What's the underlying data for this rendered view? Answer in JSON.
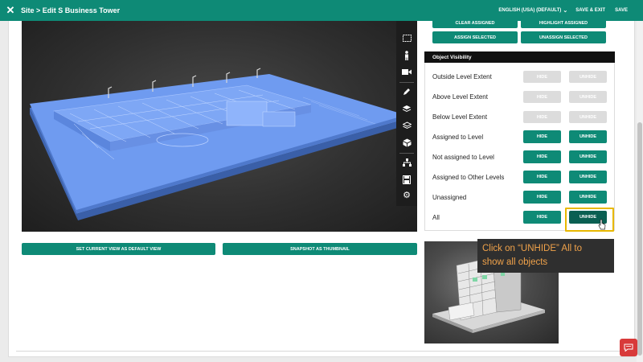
{
  "header": {
    "title": "Site > Edit S Business Tower",
    "language": "ENGLISH (USA) (DEFAULT)",
    "save_exit": "SAVE & EXIT",
    "save": "SAVE"
  },
  "assign_buttons": {
    "clear_assigned": "CLEAR ASSIGNED",
    "highlight_assigned": "HIGHLIGHT ASSIGNED",
    "assign_selected": "ASSIGN SELECTED",
    "unassign_selected": "UNASSIGN SELECTED"
  },
  "visibility": {
    "header": "Object Visibility",
    "rows": [
      {
        "label": "Outside Level Extent",
        "hide": "HIDE",
        "unhide": "UNHIDE",
        "enabled": false
      },
      {
        "label": "Above Level Extent",
        "hide": "HIDE",
        "unhide": "UNHIDE",
        "enabled": false
      },
      {
        "label": "Below Level Extent",
        "hide": "HIDE",
        "unhide": "UNHIDE",
        "enabled": false
      },
      {
        "label": "Assigned to Level",
        "hide": "HIDE",
        "unhide": "UNHIDE",
        "enabled": true
      },
      {
        "label": "Not assigned to Level",
        "hide": "HIDE",
        "unhide": "UNHIDE",
        "enabled": true
      },
      {
        "label": "Assigned to Other Levels",
        "hide": "HIDE",
        "unhide": "UNHIDE",
        "enabled": true
      },
      {
        "label": "Unassigned",
        "hide": "HIDE",
        "unhide": "UNHIDE",
        "enabled": true
      },
      {
        "label": "All",
        "hide": "HIDE",
        "unhide": "UNHIDE",
        "enabled": true
      }
    ]
  },
  "view_buttons": {
    "set_default": "SET CURRENT VIEW AS DEFAULT VIEW",
    "snapshot": "SNAPSHOT AS THUMBNAIL"
  },
  "tooltip": {
    "line1": "Click on “UNHIDE” All to",
    "line2": "show all objects"
  },
  "toolbar_icons": [
    "select-box-icon",
    "person-icon",
    "camera-icon",
    "pencil-icon",
    "layers-edit-icon",
    "layers-icon",
    "cube-icon",
    "hierarchy-icon",
    "save-icon",
    "gear-icon"
  ],
  "colors": {
    "accent": "#0e8a76",
    "highlight": "#e8b800",
    "tooltip_text": "#f0a24a",
    "model": "#6f9bf0"
  }
}
